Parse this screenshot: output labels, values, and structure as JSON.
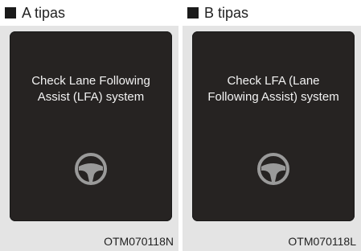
{
  "panels": [
    {
      "label": "A tipas",
      "message": "Check Lane Following\nAssist (LFA) system",
      "code": "OTM070118N"
    },
    {
      "label": "B tipas",
      "message": "Check LFA (Lane\nFollowing Assist) system",
      "code": "OTM070118L"
    }
  ],
  "icons": {
    "wheel": "steering-wheel-icon"
  },
  "colors": {
    "screen": "#262322",
    "frame": "#e4e4e4",
    "icon": "#9a9a9a"
  }
}
